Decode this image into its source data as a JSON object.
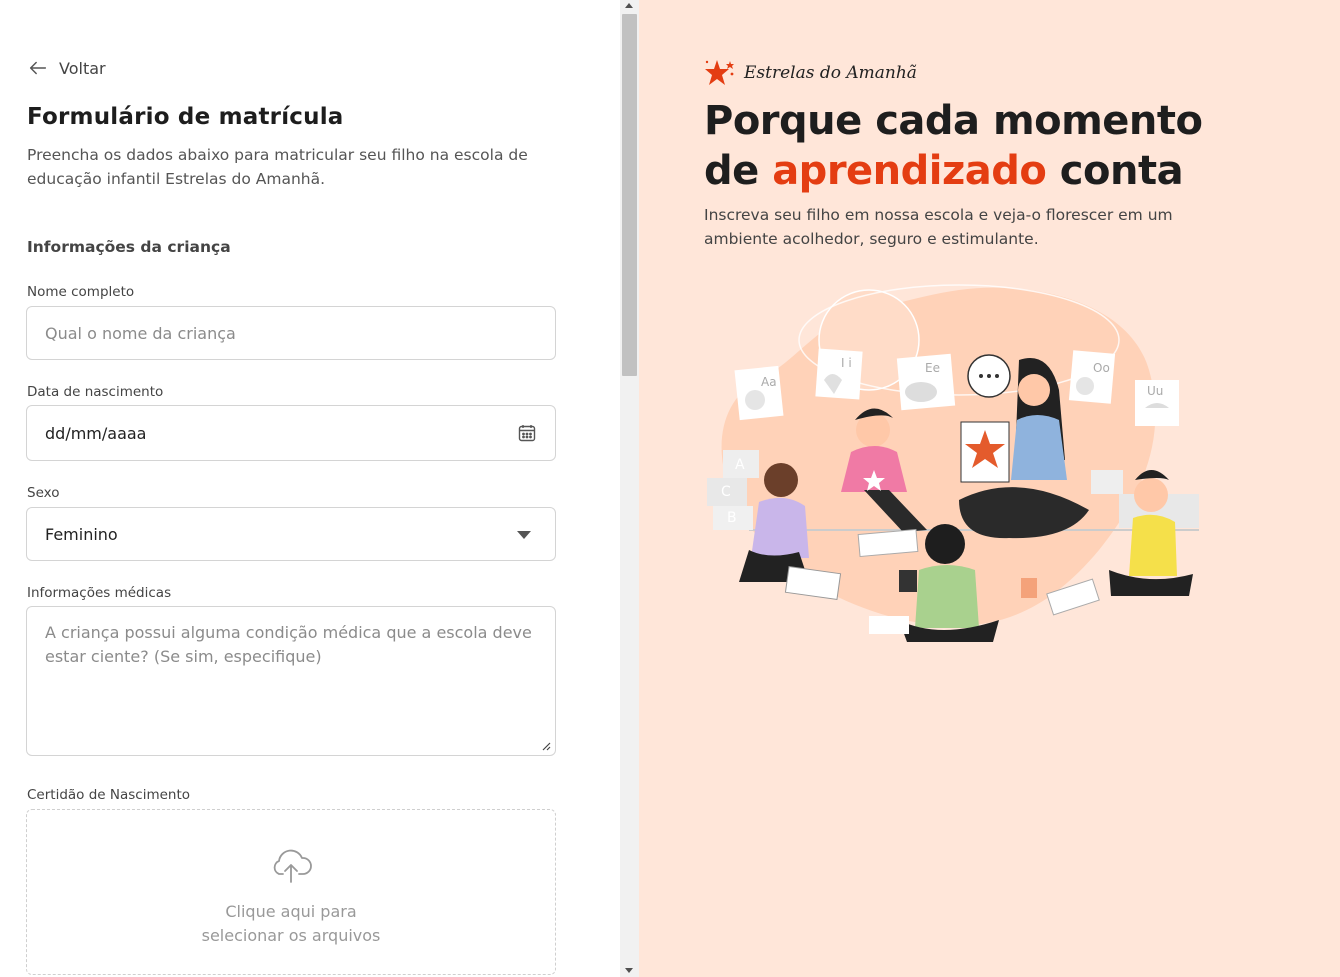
{
  "form": {
    "back_label": "Voltar",
    "title": "Formulário de matrícula",
    "subtitle": "Preencha os dados abaixo para matricular seu filho na escola de educação infantil Estrelas do Amanhã.",
    "section_title": "Informações da criança",
    "name": {
      "label": "Nome completo",
      "placeholder": "Qual o nome da criança"
    },
    "birth": {
      "label": "Data de nascimento",
      "value": "dd/mm/aaaa"
    },
    "sex": {
      "label": "Sexo",
      "value": "Feminino"
    },
    "medical": {
      "label": "Informações médicas",
      "placeholder": "A criança possui alguma condição médica que a escola deve estar ciente? (Se sim, especifique)"
    },
    "certificate": {
      "label": "Certidão de Nascimento",
      "upload_line1": "Clique aqui para",
      "upload_line2": "selecionar os arquivos"
    }
  },
  "hero": {
    "brand": "Estrelas do Amanhã",
    "headline_part1": "Porque cada momento de ",
    "headline_accent": "aprendizado",
    "headline_part2": " conta",
    "lead": "Inscreva seu filho em nossa escola e veja-o florescer em um ambiente acolhedor, seguro e estimulante.",
    "illustration_cards": [
      "Aa",
      "I i",
      "Ee",
      "Oo",
      "Uu"
    ],
    "illustration_blocks": [
      "A",
      "C",
      "B"
    ]
  },
  "colors": {
    "accent": "#e43d12",
    "hero_background": "#ffe6d9",
    "input_border": "#d4d4d4"
  },
  "icons": {
    "back": "arrow-left-icon",
    "date": "calendar-icon",
    "select": "caret-down-icon",
    "upload": "cloud-upload-icon",
    "brand": "star-icon"
  }
}
